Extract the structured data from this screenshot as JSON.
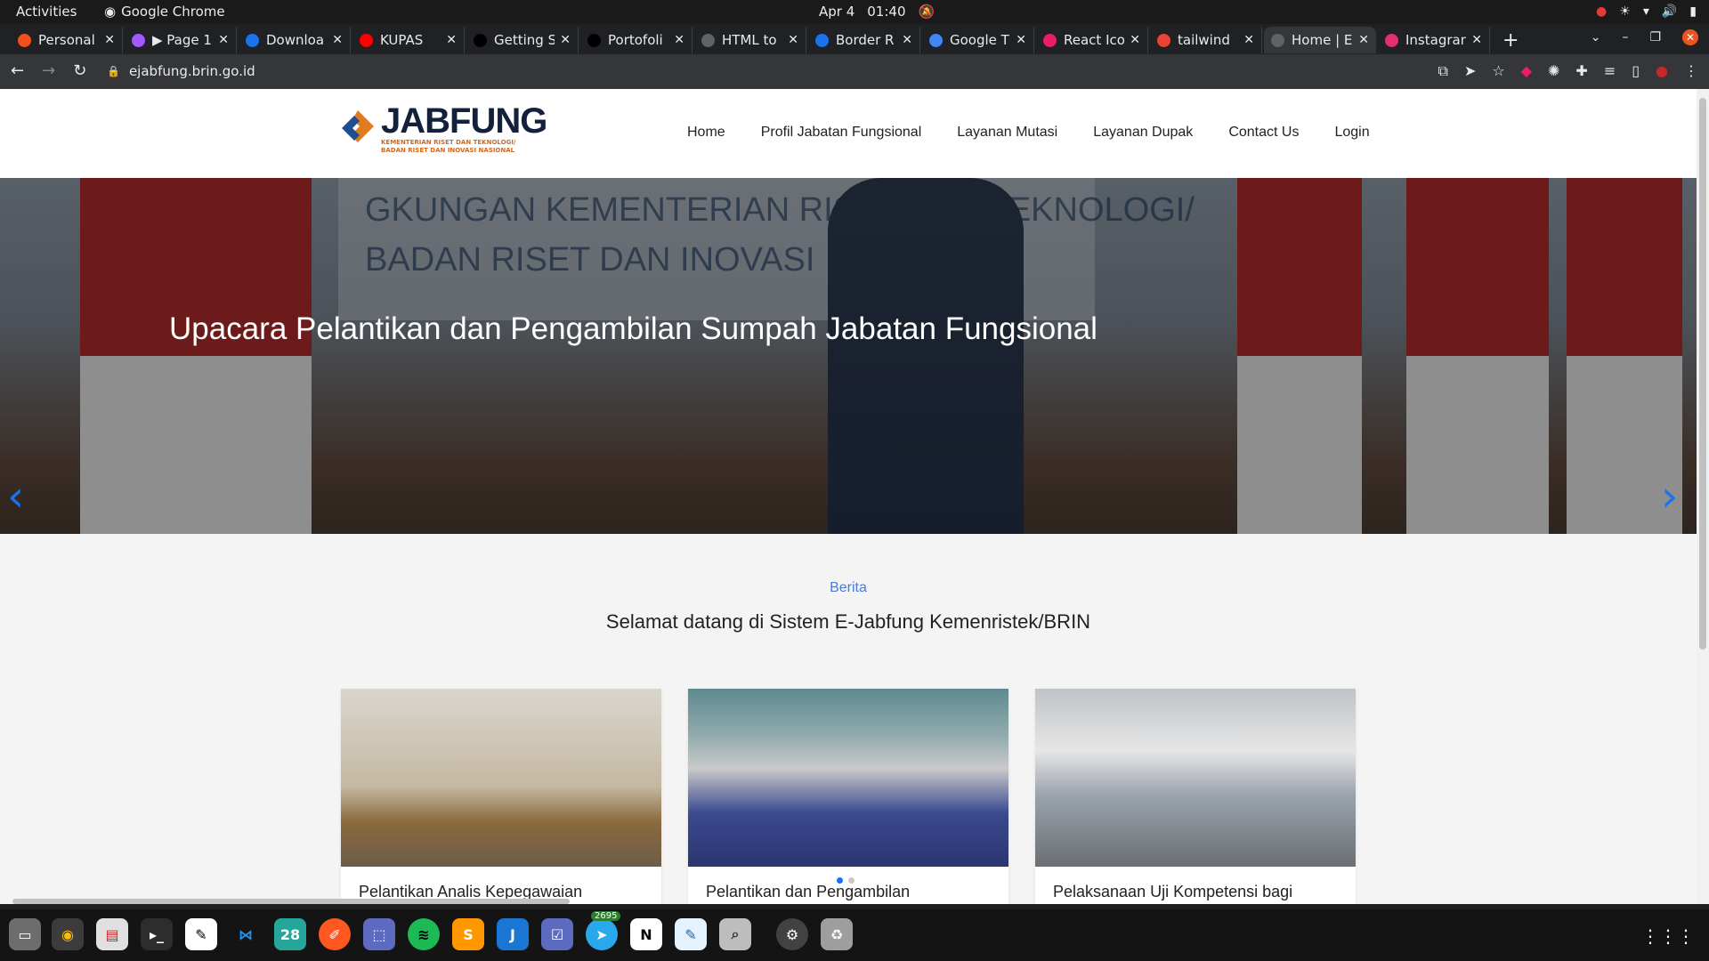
{
  "topbar": {
    "activities": "Activities",
    "app": "Google Chrome",
    "date": "Apr 4",
    "time": "01:40"
  },
  "tabs": [
    {
      "title": "Personal",
      "color": "#f24e1e"
    },
    {
      "title": "▶ Page 1",
      "color": "#a259ff"
    },
    {
      "title": "Downloa",
      "color": "#1a73e8"
    },
    {
      "title": "KUPAS",
      "color": "#ff0000"
    },
    {
      "title": "Getting S",
      "color": "#000000"
    },
    {
      "title": "Portofoli",
      "color": "#000000"
    },
    {
      "title": "HTML to",
      "color": "#5f6368"
    },
    {
      "title": "Border R",
      "color": "#1a73e8"
    },
    {
      "title": "Google T",
      "color": "#4285f4"
    },
    {
      "title": "React Ico",
      "color": "#e91e63"
    },
    {
      "title": "tailwind",
      "color": "#ea4335"
    },
    {
      "title": "Home | E",
      "color": "#5f6368"
    },
    {
      "title": "Instagran",
      "color": "#e1306c"
    }
  ],
  "toolbar": {
    "url": "ejabfung.brin.go.id"
  },
  "site": {
    "logo": {
      "big": "JABFUNG",
      "line1": "KEMENTERIAN RISET DAN TEKNOLOGI/",
      "line2": "BADAN RISET DAN INOVASI NASIONAL"
    },
    "menu": [
      "Home",
      "Profil Jabatan Fungsional",
      "Layanan Mutasi",
      "Layanan Dupak",
      "Contact Us",
      "Login"
    ]
  },
  "hero": {
    "banner_line1": "GKUNGAN KEMENTERIAN RISET DAN TEKNOLOGI/",
    "banner_line2": "BADAN RISET DAN INOVASI",
    "title": "Upacara Pelantikan dan Pengambilan Sumpah Jabatan Fungsional"
  },
  "news": {
    "kicker": "Berita",
    "heading": "Selamat datang di Sistem E-Jabfung Kemenristek/BRIN",
    "cards": [
      {
        "title": "Pelantikan Analis Kepegawaian"
      },
      {
        "title": "Pelantikan dan Pengambilan"
      },
      {
        "title": "Pelaksanaan Uji Kompetensi bagi"
      }
    ]
  },
  "dock": {
    "telegram_badge": "2695",
    "calendar_day": "28"
  }
}
